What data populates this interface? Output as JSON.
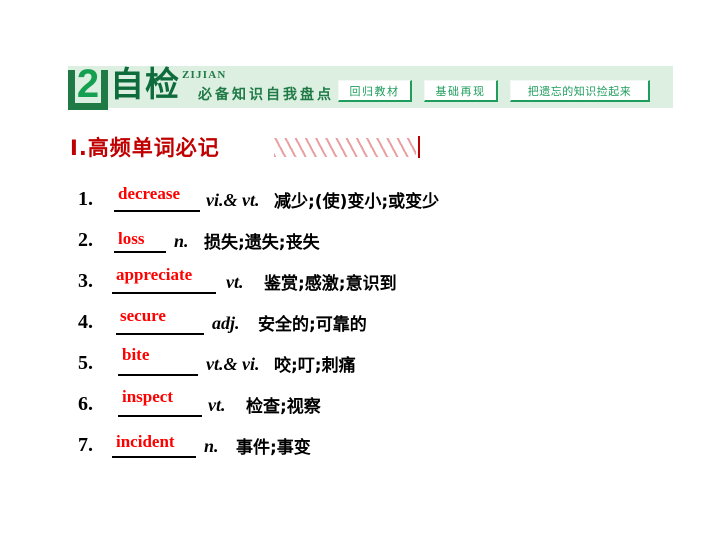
{
  "header": {
    "badge_number": "2",
    "title_cn": "自检",
    "title_pinyin": "ZIJIAN",
    "subtitle_cn": "必备知识自我盘点",
    "tags": [
      {
        "label": "回归教材"
      },
      {
        "label": "基础再现"
      },
      {
        "label": "把遗忘的知识捡起来"
      }
    ]
  },
  "section": {
    "title": "Ⅰ.高频单词必记"
  },
  "vocab": {
    "items": [
      {
        "num": "1.",
        "word": "decrease",
        "pos": "vi.& vt.",
        "definition": "减少;(使)变小;或变少"
      },
      {
        "num": "2.",
        "word": "loss",
        "pos": "n.",
        "definition": "损失;遗失;丧失"
      },
      {
        "num": "3.",
        "word": "appreciate",
        "pos": "vt.",
        "definition": "鉴赏;感激;意识到"
      },
      {
        "num": "4.",
        "word": "secure",
        "pos": "adj.",
        "definition": "安全的;可靠的"
      },
      {
        "num": "5.",
        "word": "bite",
        "pos": "vt.& vi.",
        "definition": "咬;叮;刺痛"
      },
      {
        "num": "6.",
        "word": "inspect",
        "pos": "vt.",
        "definition": "检查;视察"
      },
      {
        "num": "7.",
        "word": "incident",
        "pos": "n.",
        "definition": "事件;事变"
      }
    ]
  },
  "colors": {
    "band_bg": "#dcefe0",
    "green_dark": "#0e6b3c",
    "green_mid": "#1f7a46",
    "green_bright": "#14a050",
    "tag_green": "#1f9d5c",
    "title_red": "#c00000",
    "word_red": "#ff0000",
    "hatch_pink": "#e8a0a0"
  }
}
